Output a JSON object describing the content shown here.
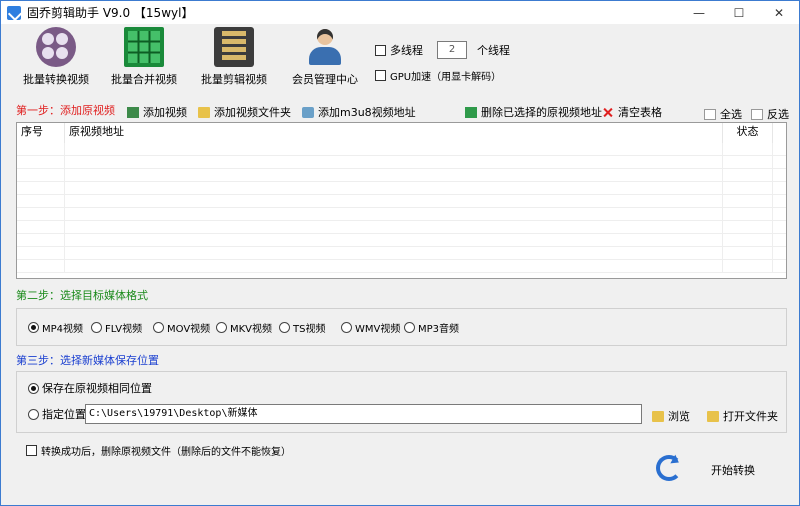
{
  "window": {
    "title": "固乔剪辑助手 V9.0 【15wyl】",
    "minimize": "—",
    "maximize": "☐",
    "close": "✕"
  },
  "toolbar": {
    "batch_convert": "批量转换视频",
    "batch_merge": "批量合并视频",
    "batch_edit": "批量剪辑视频",
    "member_center": "会员管理中心"
  },
  "options": {
    "multithread_label": "多线程",
    "thread_count": "2",
    "thread_unit": "个线程",
    "gpu_label": "GPU加速（用显卡解码）"
  },
  "step1": {
    "title": "第一步：添加原视频",
    "add_video": "添加视频",
    "add_folder": "添加视频文件夹",
    "add_m3u8": "添加m3u8视频地址",
    "remove_selected": "删除已选择的原视频地址",
    "clear_table": "清空表格",
    "select_all": "全选",
    "invert": "反选",
    "columns": {
      "seq": "序号",
      "path": "原视频地址",
      "status": "状态"
    }
  },
  "step2": {
    "title": "第二步：选择目标媒体格式",
    "formats": [
      "MP4视频",
      "FLV视频",
      "MOV视频",
      "MKV视频",
      "TS视频",
      "WMV视频",
      "MP3音频"
    ],
    "selected": "MP4视频"
  },
  "step3": {
    "title": "第三步：选择新媒体保存位置",
    "same_location": "保存在原视频相同位置",
    "custom_location": "指定位置",
    "path_value": "C:\\Users\\19791\\Desktop\\新媒体",
    "browse": "浏览",
    "open_folder": "打开文件夹"
  },
  "footer": {
    "delete_after": "转换成功后，删除原视频文件（删除后的文件不能恢复）",
    "start": "开始转换"
  }
}
